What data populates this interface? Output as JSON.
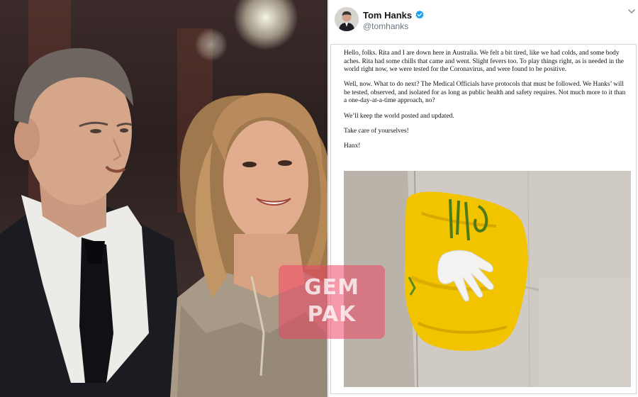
{
  "tweet": {
    "display_name": "Tom Hanks",
    "handle": "@tomhanks",
    "paragraphs": [
      "Hello, folks. Rita and I are down here in Australia. We felt a bit tired, like we had colds, and some body aches. Rita had some chills that came and went. Slight fevers too. To play things right, as is needed in the world right now, we were tested for the Coronavirus, and were found to be positive.",
      "Well, now. What to do next? The Medical Officials have protocols that must be followed. We Hanks’ will be tested, observed, and isolated for as long as public health and safety requires.  Not much more to it than a one-day-at-a-time approach, no?",
      "We’ll keep the world posted and updated.",
      "Take care of yourselves!",
      "Hanx!"
    ],
    "icons": {
      "verified": "verified-badge-icon",
      "caret": "chevron-down-icon"
    }
  },
  "watermark": {
    "line1": "GEM",
    "line2": "PAK"
  },
  "colors": {
    "verified": "#1da1f2",
    "bag": "#f2c400",
    "watermark": "#ee4664"
  }
}
